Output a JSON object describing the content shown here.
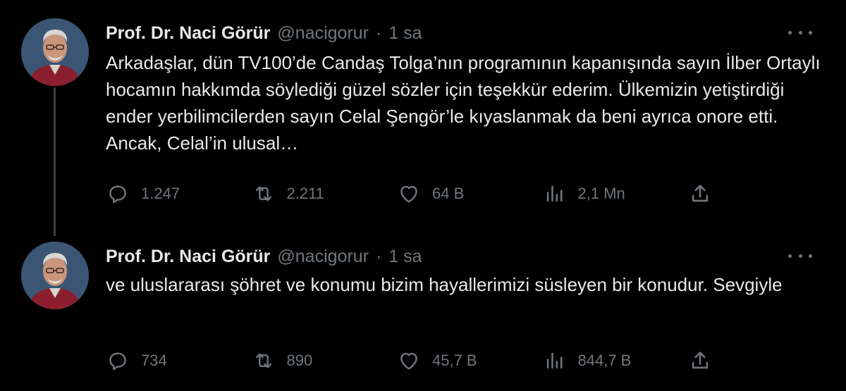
{
  "tweets": [
    {
      "author_name": "Prof. Dr. Naci Görür",
      "handle": "@nacigorur",
      "separator": "·",
      "time": "1 sa",
      "text": "Arkadaşlar, dün TV100’de Candaş Tolga’nın programının kapanışında sayın İlber Ortaylı hocamın hakkımda söylediği güzel sözler için teşekkür ederim. Ülkemizin yetiştirdiği ender yerbilimcilerden sayın Celal Şengör’le kıyaslanmak da beni ayrıca onore etti. Ancak, Celal’in ulusal…",
      "replies": "1.247",
      "retweets": "2.211",
      "likes": "64 B",
      "views": "2,1 Mn"
    },
    {
      "author_name": "Prof. Dr. Naci Görür",
      "handle": "@nacigorur",
      "separator": "·",
      "time": "1 sa",
      "text": "ve uluslararası şöhret ve konumu bizim hayallerimizi süsleyen bir konudur. Sevgiyle",
      "replies": "734",
      "retweets": "890",
      "likes": "45,7 B",
      "views": "844,7 B"
    }
  ],
  "icons": {
    "reply": "reply-icon",
    "retweet": "retweet-icon",
    "like": "heart-icon",
    "views": "views-icon",
    "share": "share-icon",
    "more": "more-icon"
  },
  "colors": {
    "background": "#000000",
    "text": "#e7e9ea",
    "secondary": "#71767b",
    "thread_line": "#3a3f44"
  }
}
